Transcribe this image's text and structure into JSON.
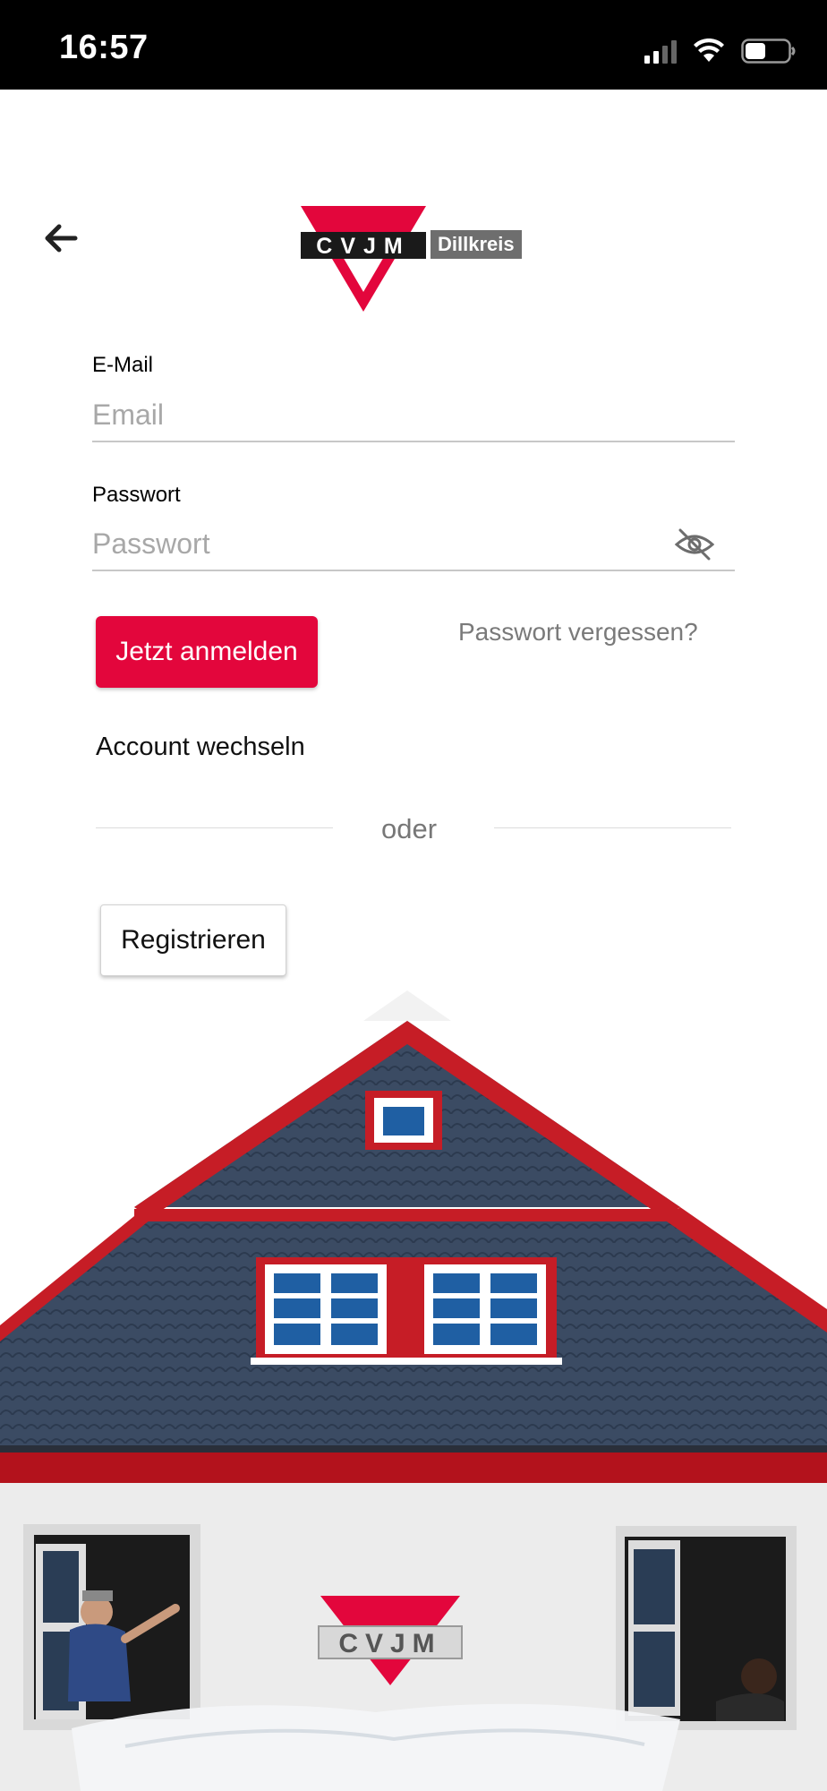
{
  "status_bar": {
    "time": "16:57"
  },
  "header": {
    "logo_text": "CVJM",
    "logo_subtitle": "Dillkreis"
  },
  "form": {
    "email": {
      "label": "E-Mail",
      "placeholder": "Email",
      "value": ""
    },
    "password": {
      "label": "Passwort",
      "placeholder": "Passwort",
      "value": ""
    },
    "login_button": "Jetzt anmelden",
    "forgot_password": "Passwort vergessen?",
    "switch_account": "Account wechseln",
    "divider": "oder",
    "register_button": "Registrieren"
  },
  "photo": {
    "sign_text": "CVJM"
  },
  "colors": {
    "brand_red": "#e3063c",
    "logo_dark": "#1a1a1a",
    "label_gray": "#6e6e6e"
  },
  "icons": [
    "signal-icon",
    "wifi-icon",
    "battery-icon",
    "back-arrow-icon",
    "eye-off-icon"
  ]
}
